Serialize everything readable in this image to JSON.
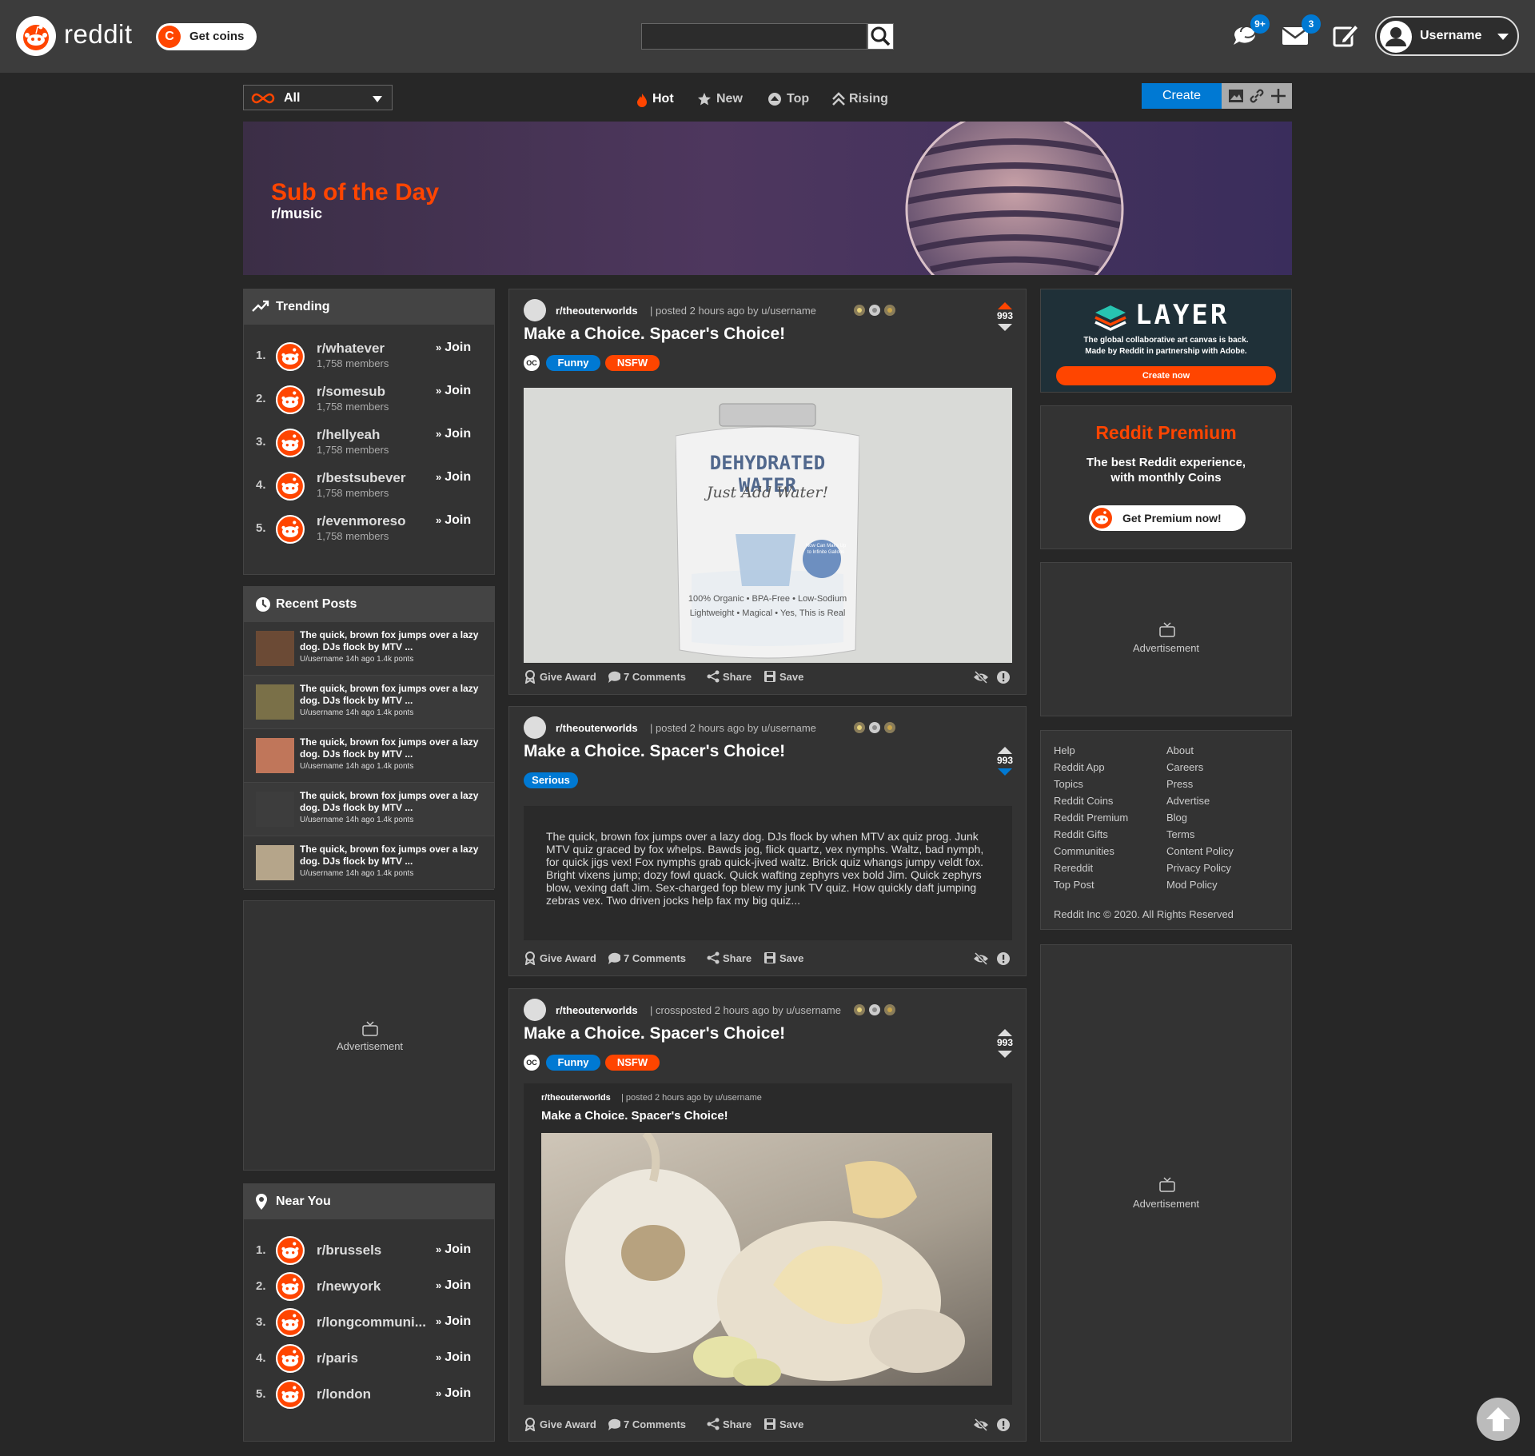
{
  "header": {
    "logo_text": "reddit",
    "coins_button": "Get coins",
    "coins_letter": "C",
    "search_placeholder": "",
    "chat_badge": "9+",
    "mail_badge": "3",
    "username": "Username"
  },
  "toolbar": {
    "filter_value": "All",
    "sort_tabs": [
      "Hot",
      "New",
      "Top",
      "Rising"
    ],
    "create_label": "Create"
  },
  "banner": {
    "title": "Sub of the Day",
    "subreddit": "r/music"
  },
  "trending": {
    "title": "Trending",
    "join_label": "Join",
    "items": [
      {
        "num": "1.",
        "name": "r/whatever",
        "members": "1,758 members"
      },
      {
        "num": "2.",
        "name": "r/somesub",
        "members": "1,758 members"
      },
      {
        "num": "3.",
        "name": "r/hellyeah",
        "members": "1,758 members"
      },
      {
        "num": "4.",
        "name": "r/bestsubever",
        "members": "1,758 members"
      },
      {
        "num": "5.",
        "name": "r/evenmoreso",
        "members": "1,758 members"
      }
    ]
  },
  "recent_posts": {
    "title": "Recent Posts",
    "items": [
      {
        "title": "The quick, brown fox jumps over a lazy dog. DJs flock by MTV ...",
        "meta": "U/username 14h ago 1.4k ponts",
        "thumb_color": "#6b4a35"
      },
      {
        "title": "The quick, brown fox jumps over a lazy dog. DJs flock by MTV ...",
        "meta": "U/username 14h ago 1.4k ponts",
        "thumb_color": "#7a7048"
      },
      {
        "title": "The quick, brown fox jumps over a lazy dog. DJs flock by MTV ...",
        "meta": "U/username 14h ago 1.4k ponts",
        "thumb_color": "#c0765a"
      },
      {
        "title": "The quick, brown fox jumps over a lazy dog. DJs flock by MTV ...",
        "meta": "U/username 14h ago 1.4k ponts",
        "thumb_color": "#3d3d3d"
      },
      {
        "title": "The quick, brown fox jumps over a lazy dog. DJs flock by MTV ...",
        "meta": "U/username 14h ago 1.4k ponts",
        "thumb_color": "#b5a58a"
      }
    ]
  },
  "advertisement_label": "Advertisement",
  "near_you": {
    "title": "Near You",
    "join_label": "Join",
    "items": [
      {
        "num": "1.",
        "name": "r/brussels"
      },
      {
        "num": "2.",
        "name": "r/newyork"
      },
      {
        "num": "3.",
        "name": "r/longcommuni..."
      },
      {
        "num": "4.",
        "name": "r/paris"
      },
      {
        "num": "5.",
        "name": "r/london"
      }
    ]
  },
  "posts": [
    {
      "subreddit": "r/theouterworlds",
      "meta": "| posted 2 hours ago by u/username",
      "title": "Make a Choice. Spacer's Choice!",
      "oc": "OC",
      "flairs": [
        {
          "label": "Funny",
          "color": "#0079d3"
        },
        {
          "label": "NSFW",
          "color": "#ff4500"
        }
      ],
      "votes": "993",
      "vote_state": "up",
      "image_text_1": "DEHYDRATED WATER",
      "image_text_2": "Just Add Water!",
      "image_text_3": "100% Organic • BPA-Free • Low-Sodium",
      "image_text_4": "Lightweight • Magical • Yes, This is Real",
      "image_badge": "Now Can Make Up to Infinite Gallons"
    },
    {
      "subreddit": "r/theouterworlds",
      "meta": "| posted 2 hours ago by u/username",
      "title": "Make a Choice. Spacer's Choice!",
      "flairs": [
        {
          "label": "Serious",
          "color": "#0079d3"
        }
      ],
      "votes": "993",
      "vote_state": "down",
      "body": "The quick, brown fox jumps over a lazy dog. DJs flock by when MTV ax quiz prog. Junk MTV quiz graced by fox whelps. Bawds jog, flick quartz, vex nymphs. Waltz, bad nymph, for quick jigs vex! Fox nymphs grab quick-jived waltz. Brick quiz whangs jumpy veldt fox. Bright vixens jump; dozy fowl quack. Quick wafting zephyrs vex bold Jim. Quick zephyrs blow, vexing daft Jim. Sex-charged fop blew my junk TV quiz. How quickly daft jumping zebras vex. Two driven jocks help fax my big quiz..."
    },
    {
      "subreddit": "r/theouterworlds",
      "meta": "| crossposted 2 hours ago by u/username",
      "title": "Make a Choice. Spacer's Choice!",
      "oc": "OC",
      "flairs": [
        {
          "label": "Funny",
          "color": "#0079d3"
        },
        {
          "label": "NSFW",
          "color": "#ff4500"
        }
      ],
      "votes": "993",
      "vote_state": "none",
      "crosspost": {
        "subreddit": "r/theouterworlds",
        "meta": "| posted 2 hours ago by u/username",
        "title": "Make a Choice. Spacer's Choice!"
      }
    }
  ],
  "post_actions": {
    "award": "Give Award",
    "comments": "7 Comments",
    "share": "Share",
    "save": "Save"
  },
  "layer_ad": {
    "brand": "LAYER",
    "line1": "The global collaborative art canvas is back.",
    "line2": "Made by Reddit in partnership with Adobe.",
    "button": "Create now"
  },
  "premium": {
    "title": "Reddit Premium",
    "line1": "The best Reddit experience,",
    "line2": "with monthly Coins",
    "button": "Get Premium now!"
  },
  "footer": {
    "left": [
      "Help",
      "Reddit App",
      "Topics",
      "Reddit Coins",
      "Reddit Premium",
      "Reddit Gifts",
      "Communities",
      "Rereddit",
      "Top Post"
    ],
    "right": [
      "About",
      "Careers",
      "Press",
      "Advertise",
      "Blog",
      "Terms",
      "Content Policy",
      "Privacy Policy",
      "Mod Policy"
    ],
    "copyright": "Reddit Inc © 2020. All Rights Reserved"
  },
  "colors": {
    "accent": "#ff4500",
    "blue": "#0079d3",
    "background": "#272727",
    "card": "#333333"
  }
}
